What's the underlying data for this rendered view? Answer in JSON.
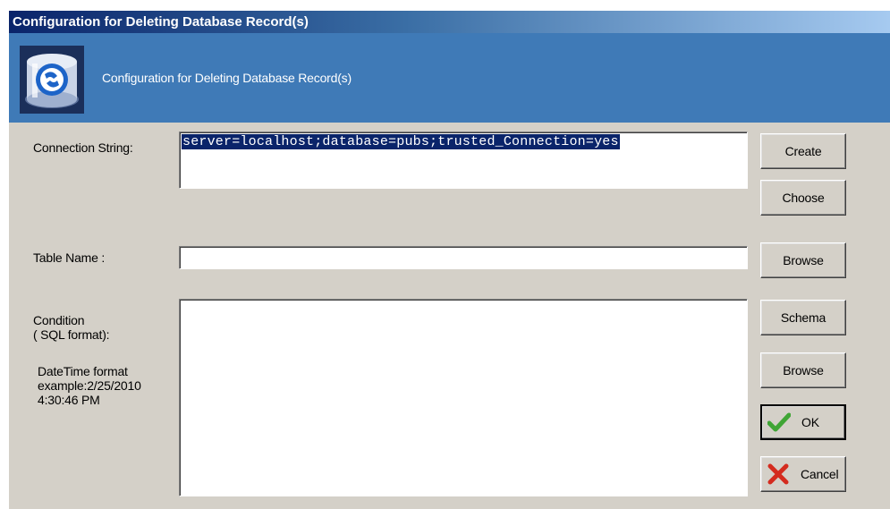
{
  "window": {
    "title": "Configuration for Deleting Database Record(s)"
  },
  "banner": {
    "text": "Configuration for Deleting Database Record(s)",
    "logo_icon": "database-connection-icon"
  },
  "labels": {
    "connection_string": "Connection String:",
    "table_name": "Table Name :",
    "condition_line1": "Condition",
    "condition_line2": "( SQL format):",
    "datetime_line1": "DateTime format",
    "datetime_line2": "example:2/25/2010",
    "datetime_line3": "4:30:46 PM"
  },
  "fields": {
    "connection_string_value": "server=localhost;database=pubs;trusted_Connection=yes",
    "table_name_value": "",
    "condition_value": ""
  },
  "buttons": {
    "create": "Create",
    "choose": "Choose",
    "browse_table": "Browse",
    "schema": "Schema",
    "browse_condition": "Browse",
    "ok": "OK",
    "cancel": "Cancel"
  },
  "icons": {
    "ok": "green-check-icon",
    "cancel": "red-x-icon"
  },
  "colors": {
    "title_bar": "#0a246a",
    "banner": "#3f7ab7",
    "dialog_bg": "#d4d0c8",
    "selection": "#0a246a"
  }
}
